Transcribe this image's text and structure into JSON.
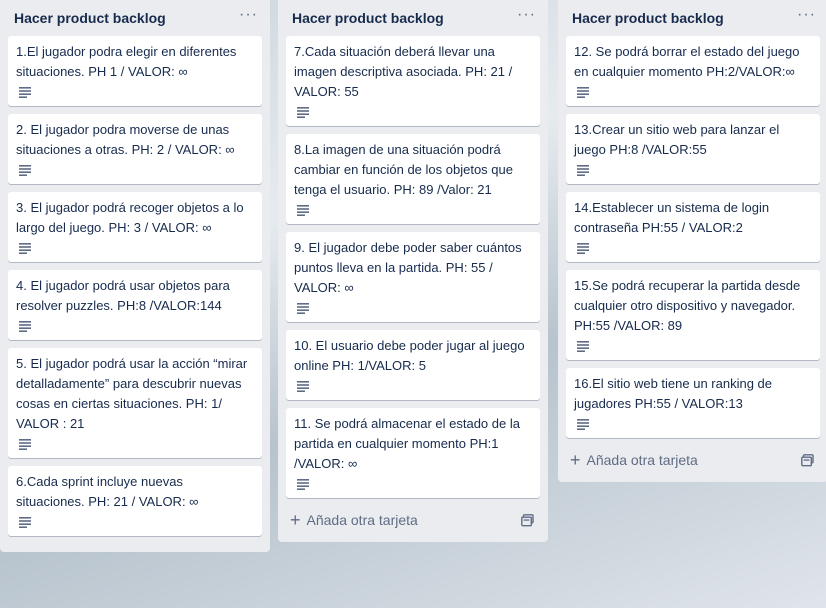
{
  "lists": [
    {
      "title": "Hacer product backlog",
      "menu": "···",
      "cards": [
        "1.El jugador podra elegir en diferentes situaciones. PH 1 / VALOR: ∞",
        "2. El jugador podra moverse de unas situaciones a otras. PH: 2 / VALOR: ∞",
        "3. El jugador podrá recoger objetos a lo largo del juego. PH: 3 / VALOR: ∞",
        "4. El jugador podrá usar objetos para resolver puzzles. PH:8 /VALOR:144",
        "5. El jugador podrá usar la acción “mirar detalladamente” para descubrir nuevas cosas en ciertas situaciones. PH: 1/ VALOR : 21",
        "6.Cada sprint incluye nuevas situaciones. PH: 21 / VALOR: ∞"
      ]
    },
    {
      "title": "Hacer product backlog",
      "menu": "···",
      "cards": [
        "7.Cada situación deberá llevar una imagen descriptiva asociada. PH: 21 / VALOR: 55",
        "8.La imagen de una situación podrá cambiar en función de los objetos que tenga el usuario. PH: 89 /Valor: 21",
        "9. El jugador debe poder saber cuántos puntos lleva en la partida. PH: 55 / VALOR: ∞",
        "10. El usuario debe poder jugar al juego online PH: 1/VALOR: 5",
        "11. Se podrá almacenar el estado de la partida en cualquier momento PH:1 /VALOR: ∞"
      ],
      "add_label": "Añada otra tarjeta"
    },
    {
      "title": "Hacer product backlog",
      "menu": "···",
      "cards": [
        "12. Se podrá borrar el estado del juego en cualquier momento PH:2/VALOR:∞",
        "13.Crear un sitio web para lanzar el juego PH:8 /VALOR:55",
        "14.Establecer un sistema de login contraseña PH:55 / VALOR:2",
        "15.Se podrá recuperar la partida desde cualquier otro dispositivo y navegador. PH:55 /VALOR: 89",
        "16.El sitio web tiene un ranking de jugadores PH:55 / VALOR:13"
      ],
      "add_label": "Añada otra tarjeta"
    }
  ],
  "icons": {
    "card_badge": "description-icon",
    "add": "plus-icon",
    "template": "card-template-icon"
  }
}
